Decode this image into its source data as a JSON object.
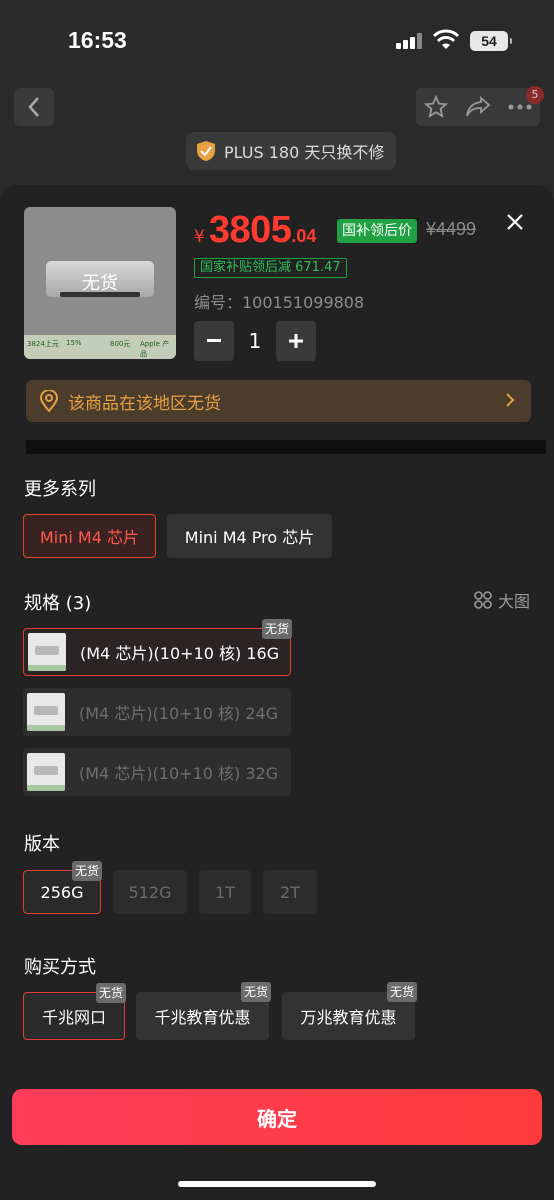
{
  "status_bar": {
    "time": "16:53",
    "battery": "54"
  },
  "nav": {
    "cart_badge": "5"
  },
  "promise": {
    "text": "PLUS 180 天只换不修"
  },
  "product": {
    "no_stock_overlay": "无货",
    "price_symbol": "¥",
    "price_int": "3805",
    "price_dec": ".04",
    "subsidy_tag": "国补领后价",
    "original_price": "¥4499",
    "subsidy_note": "国家补贴领后减 671.47",
    "sku_number": "编号：100151099808",
    "quantity": "1",
    "thumb_strip": [
      "3824上元",
      "15%",
      "800元",
      "Apple 产品"
    ]
  },
  "region": {
    "message": "该商品在该地区无货"
  },
  "series": {
    "title": "更多系列",
    "options": [
      {
        "label": "Mini M4 芯片",
        "selected": true
      },
      {
        "label": "Mini M4 Pro 芯片",
        "selected": false
      }
    ]
  },
  "spec": {
    "title": "规格 (3)",
    "big_image_label": "大图",
    "options": [
      {
        "label": "(M4 芯片)(10+10 核) 16G",
        "no_stock": "无货",
        "selected": true
      },
      {
        "label": "(M4 芯片)(10+10 核) 24G",
        "selected": false
      },
      {
        "label": "(M4 芯片)(10+10 核) 32G",
        "selected": false
      }
    ]
  },
  "version": {
    "title": "版本",
    "options": [
      {
        "label": "256G",
        "no_stock": "无货",
        "selected": true
      },
      {
        "label": "512G"
      },
      {
        "label": "1T"
      },
      {
        "label": "2T"
      }
    ]
  },
  "purchase": {
    "title": "购买方式",
    "options": [
      {
        "label": "千兆网口",
        "no_stock": "无货",
        "selected": true
      },
      {
        "label": "千兆教育优惠",
        "no_stock": "无货"
      },
      {
        "label": "万兆教育优惠",
        "no_stock": "无货"
      }
    ]
  },
  "confirm": {
    "label": "确定"
  },
  "colors": {
    "accent": "#ff3b30",
    "subsidy_green": "#1fa043",
    "warning": "#e8a043"
  }
}
